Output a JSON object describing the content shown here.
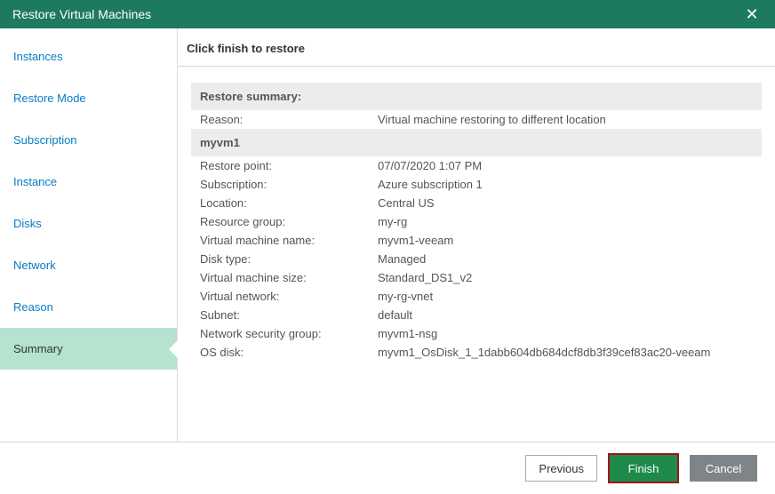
{
  "titlebar": {
    "title": "Restore Virtual Machines",
    "close": "✕"
  },
  "sidebar": {
    "items": [
      {
        "label": "Instances"
      },
      {
        "label": "Restore Mode"
      },
      {
        "label": "Subscription"
      },
      {
        "label": "Instance"
      },
      {
        "label": "Disks"
      },
      {
        "label": "Network"
      },
      {
        "label": "Reason"
      },
      {
        "label": "Summary"
      }
    ],
    "activeIndex": 7
  },
  "main": {
    "header": "Click finish to restore",
    "sections": [
      {
        "title": "Restore summary:",
        "rows": [
          {
            "key": "Reason:",
            "val": "Virtual machine restoring to different location"
          }
        ]
      },
      {
        "title": "myvm1",
        "rows": [
          {
            "key": "Restore point:",
            "val": "07/07/2020 1:07 PM"
          },
          {
            "key": "Subscription:",
            "val": "Azure subscription 1"
          },
          {
            "key": "Location:",
            "val": "Central US"
          },
          {
            "key": "Resource group:",
            "val": "my-rg"
          },
          {
            "key": "Virtual machine name:",
            "val": "myvm1-veeam"
          },
          {
            "key": "Disk type:",
            "val": "Managed"
          },
          {
            "key": "Virtual machine size:",
            "val": "Standard_DS1_v2"
          },
          {
            "key": "Virtual network:",
            "val": "my-rg-vnet"
          },
          {
            "key": "Subnet:",
            "val": "default"
          },
          {
            "key": "Network security group:",
            "val": "myvm1-nsg"
          },
          {
            "key": "OS disk:",
            "val": "myvm1_OsDisk_1_1dabb604db684dcf8db3f39cef83ac20-veeam"
          }
        ]
      }
    ]
  },
  "footer": {
    "previous": "Previous",
    "finish": "Finish",
    "cancel": "Cancel"
  }
}
